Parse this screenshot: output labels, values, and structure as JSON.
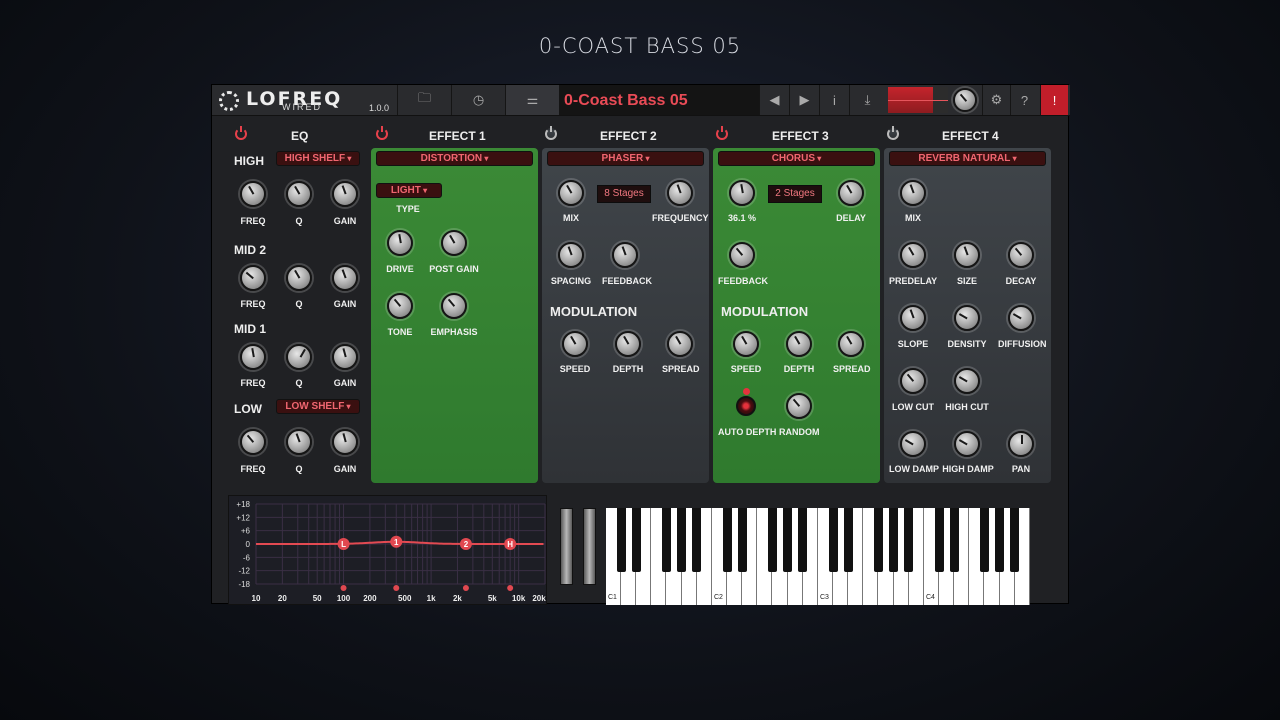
{
  "page": {
    "title": "0-COAST BASS 05"
  },
  "header": {
    "logo_text": "LOFREQ",
    "logo_sub": "WIRED",
    "version": "1.0.0",
    "preset_name": "0-Coast Bass 05",
    "icons": [
      "folder-icon",
      "clock-icon",
      "sliders-icon",
      "prev-icon",
      "next-icon",
      "info-icon",
      "save-icon",
      "volume-knob",
      "gear-icon",
      "help-icon",
      "alert-icon"
    ],
    "glyphs": {
      "folder": "🗀",
      "clock": "◷",
      "sliders": "⚌",
      "prev": "◀",
      "next": "▶",
      "info": "i",
      "save": "⤓",
      "gear": "⚙",
      "help": "?",
      "alert": "!"
    },
    "meter_level": 0.75,
    "colors": {
      "accent": "#e94b56",
      "green_panel": "#3b8a36",
      "gray_panel": "#3d4146",
      "alert": "#c21e2a"
    }
  },
  "eq": {
    "title": "EQ",
    "bands": [
      {
        "name": "HIGH",
        "type": "HIGH SHELF",
        "labels": [
          "FREQ",
          "Q",
          "GAIN"
        ]
      },
      {
        "name": "MID 2",
        "type": "",
        "labels": [
          "FREQ",
          "Q",
          "GAIN"
        ]
      },
      {
        "name": "MID 1",
        "type": "",
        "labels": [
          "FREQ",
          "Q",
          "GAIN"
        ]
      },
      {
        "name": "LOW",
        "type": "LOW SHELF",
        "labels": [
          "FREQ",
          "Q",
          "GAIN"
        ]
      }
    ]
  },
  "effect1": {
    "title": "EFFECT 1",
    "type": "DISTORTION",
    "mode": "LIGHT",
    "mode_label": "TYPE",
    "knobs": [
      "DRIVE",
      "POST GAIN",
      "TONE",
      "EMPHASIS"
    ]
  },
  "effect2": {
    "title": "EFFECT 2",
    "type": "PHASER",
    "stages": "8 Stages",
    "knobs": [
      "MIX",
      "FREQUENCY",
      "SPACING",
      "FEEDBACK"
    ],
    "mod_title": "MODULATION",
    "mod_knobs": [
      "SPEED",
      "DEPTH",
      "SPREAD"
    ]
  },
  "effect3": {
    "title": "EFFECT 3",
    "type": "CHORUS",
    "stages": "2 Stages",
    "mix_value": "36.1 %",
    "knobs": [
      "DELAY",
      "FEEDBACK"
    ],
    "mod_title": "MODULATION",
    "mod_knobs": [
      "SPEED",
      "DEPTH",
      "SPREAD"
    ],
    "auto_depth": "AUTO DEPTH",
    "random": "RANDOM"
  },
  "effect4": {
    "title": "EFFECT 4",
    "type": "REVERB NATURAL",
    "knobs": [
      "MIX",
      "PREDELAY",
      "SIZE",
      "DECAY",
      "SLOPE",
      "DENSITY",
      "DIFFUSION",
      "LOW CUT",
      "HIGH CUT",
      "LOW DAMP",
      "HIGH DAMP",
      "PAN"
    ]
  },
  "eq_graph": {
    "y_ticks": [
      "+18",
      "+12",
      "+6",
      "0",
      "-6",
      "-12",
      "-18"
    ],
    "x_ticks": [
      "10",
      "20",
      "50",
      "100",
      "200",
      "500",
      "1k",
      "2k",
      "5k",
      "10k",
      "20k"
    ],
    "nodes": [
      {
        "label": "L",
        "freq": 100,
        "gain": 0
      },
      {
        "label": "1",
        "freq": 400,
        "gain": 1
      },
      {
        "label": "2",
        "freq": 2500,
        "gain": 0
      },
      {
        "label": "H",
        "freq": 8000,
        "gain": 0
      }
    ]
  },
  "keyboard": {
    "octave_labels": [
      "C1",
      "C2",
      "C3",
      "C4"
    ]
  }
}
